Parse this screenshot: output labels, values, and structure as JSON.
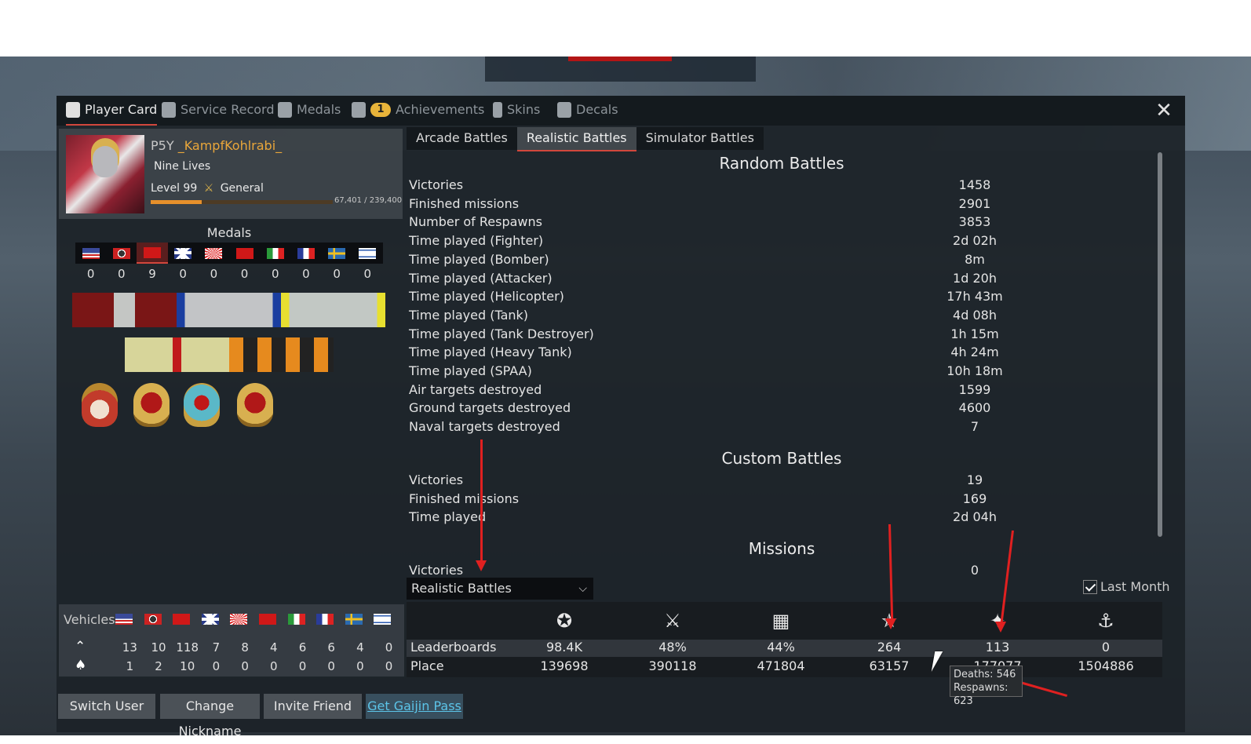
{
  "tabs": [
    {
      "label": "Player Card",
      "icon": "player-card-icon",
      "active": true
    },
    {
      "label": "Service Record",
      "icon": "service-record-icon"
    },
    {
      "label": "Medals",
      "icon": "medal-icon"
    },
    {
      "label": "Achievements",
      "icon": "achievements-icon",
      "badge": "1"
    },
    {
      "label": "Skins",
      "icon": "skins-icon"
    },
    {
      "label": "Decals",
      "icon": "decals-icon"
    }
  ],
  "profile": {
    "tag": "P5Y",
    "nickname": "_KampfKohlrabi_",
    "title": "Nine Lives",
    "level": "Level 99",
    "rank": "General",
    "xp_text": "67,401 / 239,400",
    "xp_fraction": 0.2816
  },
  "medals": {
    "heading": "Medals",
    "nations": [
      "usa",
      "germany",
      "ussr",
      "uk",
      "japan",
      "china",
      "italy",
      "france",
      "sweden",
      "israel"
    ],
    "selected": "ussr",
    "counts": [
      "0",
      "0",
      "9",
      "0",
      "0",
      "0",
      "0",
      "0",
      "0",
      "0"
    ]
  },
  "vehicles": {
    "label": "Vehicles",
    "nations": [
      "usa",
      "germany",
      "ussr",
      "uk",
      "japan",
      "china",
      "italy",
      "france",
      "sweden",
      "israel"
    ],
    "row1_icon": "aircraft-rank-icon",
    "row1": [
      "13",
      "10",
      "118",
      "7",
      "8",
      "4",
      "6",
      "6",
      "4",
      "0"
    ],
    "row2_icon": "ace-icon",
    "row2": [
      "1",
      "2",
      "10",
      "0",
      "0",
      "0",
      "0",
      "0",
      "0",
      "0"
    ]
  },
  "mode_tabs": [
    {
      "label": "Arcade Battles"
    },
    {
      "label": "Realistic Battles",
      "active": true
    },
    {
      "label": "Simulator Battles"
    }
  ],
  "random": {
    "heading": "Random Battles",
    "rows": [
      {
        "label": "Victories",
        "value": "1458"
      },
      {
        "label": "Finished missions",
        "value": "2901"
      },
      {
        "label": "Number of Respawns",
        "value": "3853"
      },
      {
        "label": "Time played (Fighter)",
        "value": "2d 02h"
      },
      {
        "label": "Time played (Bomber)",
        "value": "8m"
      },
      {
        "label": "Time played (Attacker)",
        "value": "1d 20h"
      },
      {
        "label": "Time played (Helicopter)",
        "value": "17h 43m"
      },
      {
        "label": "Time played (Tank)",
        "value": "4d 08h"
      },
      {
        "label": "Time played (Tank Destroyer)",
        "value": "1h 15m"
      },
      {
        "label": "Time played (Heavy Tank)",
        "value": "4h 24m"
      },
      {
        "label": "Time played (SPAA)",
        "value": "10h 18m"
      },
      {
        "label": "Air targets destroyed",
        "value": "1599"
      },
      {
        "label": "Ground targets destroyed",
        "value": "4600"
      },
      {
        "label": "Naval targets destroyed",
        "value": "7"
      }
    ]
  },
  "custom": {
    "heading": "Custom Battles",
    "rows": [
      {
        "label": "Victories",
        "value": "19"
      },
      {
        "label": "Finished missions",
        "value": "169"
      },
      {
        "label": "Time played",
        "value": "2d 04h"
      }
    ]
  },
  "missions": {
    "heading": "Missions",
    "rows": [
      {
        "label": "Victories",
        "value": "0"
      }
    ]
  },
  "leaderboard_filter": {
    "value": "Realistic Battles",
    "last_month": "Last Month",
    "last_month_checked": true
  },
  "leaderboards": {
    "icons": [
      "victories-icon",
      "kills-icon",
      "place-icon",
      "air-kills-icon",
      "ground-kills-icon",
      "naval-kills-icon"
    ],
    "row1_label": "Leaderboards",
    "row1": [
      "98.4K",
      "48%",
      "44%",
      "264",
      "113",
      "0"
    ],
    "row2_label": "Place",
    "row2": [
      "139698",
      "390118",
      "471804",
      "63157",
      "177077",
      "1504886"
    ]
  },
  "tooltip": {
    "deaths": "Deaths: 546",
    "respawns": "Respawns: 623"
  },
  "bottom_buttons": [
    {
      "label": "Switch User"
    },
    {
      "label": "Change Nickname"
    },
    {
      "label": "Invite Friend"
    },
    {
      "label": "Get Gaijin Pass"
    }
  ],
  "colors": {
    "accent": "#d2473c",
    "nickname": "#e9a63a",
    "link": "#5cc4e8",
    "annotation": "#e02020"
  }
}
